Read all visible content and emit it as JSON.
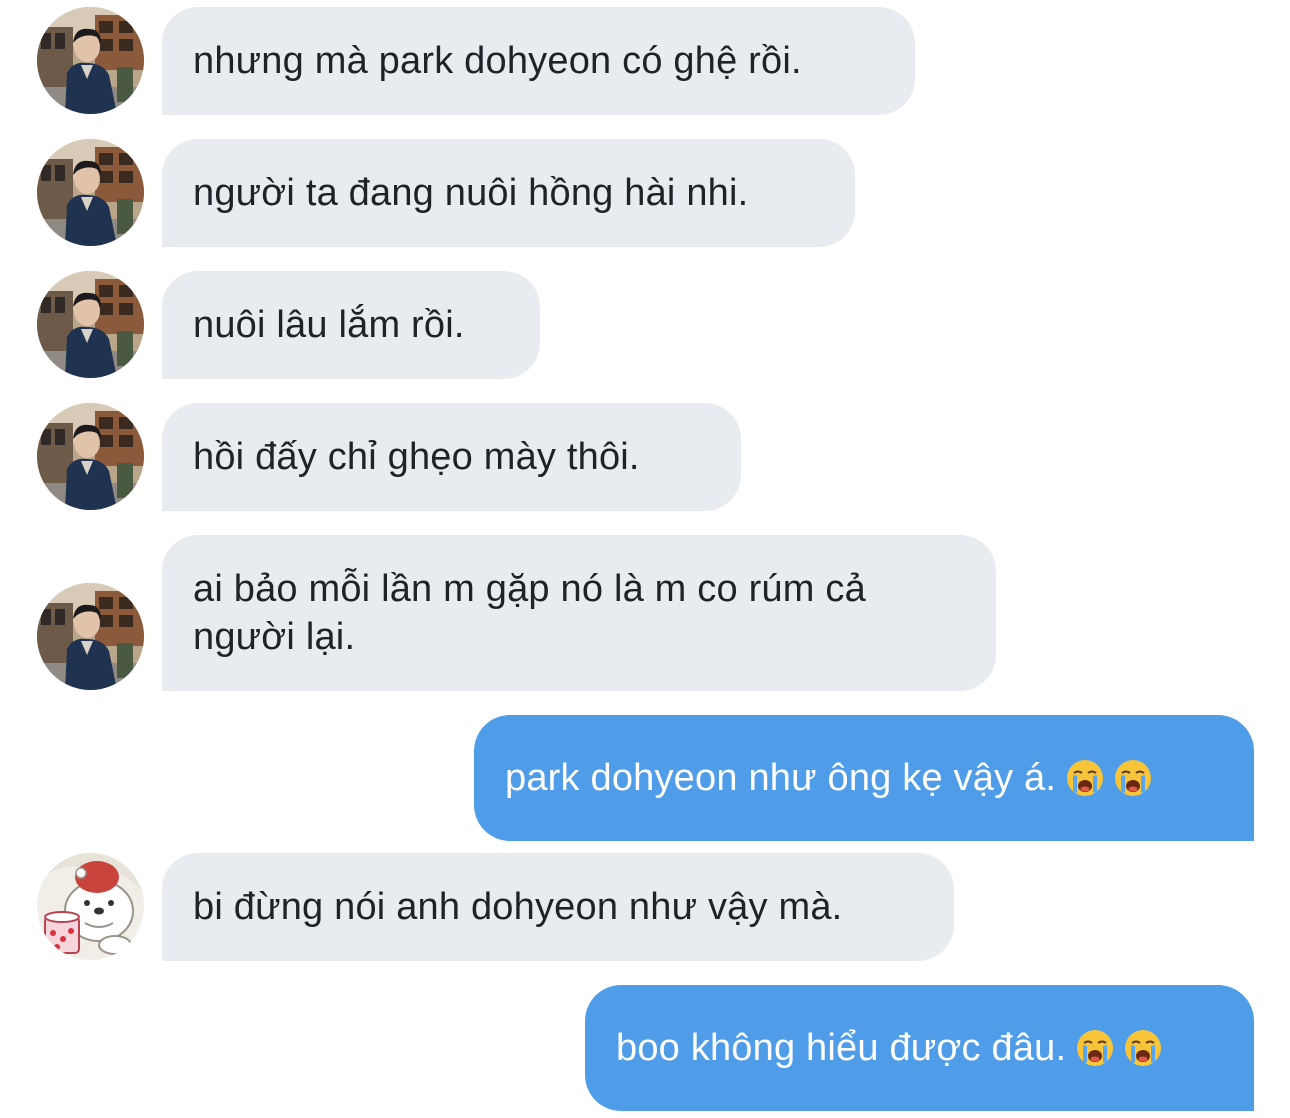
{
  "messages": [
    {
      "sender": "park",
      "text": "nhưng mà park dohyeon có ghệ rồi."
    },
    {
      "sender": "park",
      "text": "người ta đang nuôi hồng hài nhi."
    },
    {
      "sender": "park",
      "text": "nuôi lâu lắm rồi."
    },
    {
      "sender": "park",
      "text": "hồi đấy chỉ ghẹo mày thôi."
    },
    {
      "sender": "park",
      "text": "ai bảo mỗi lần m gặp nó là m co rúm cả người lại."
    },
    {
      "sender": "me",
      "text": "park dohyeon như ông kẹ vậy á.",
      "emoji": [
        "loudly-crying-face",
        "loudly-crying-face"
      ]
    },
    {
      "sender": "bear",
      "text": "bi đừng nói anh dohyeon như vậy mà."
    },
    {
      "sender": "me",
      "text": "boo không hiểu được đâu.",
      "emoji": [
        "loudly-crying-face",
        "loudly-crying-face"
      ]
    }
  ],
  "colors": {
    "incoming_bubble": "#e8ecf0",
    "outgoing_bubble": "#4f9de8",
    "incoming_text": "#1f2328",
    "outgoing_text": "#ffffff"
  },
  "avatars": {
    "park": "photo-avatar-man-in-dark-coat",
    "bear": "cartoon-polar-bear-avatar"
  }
}
